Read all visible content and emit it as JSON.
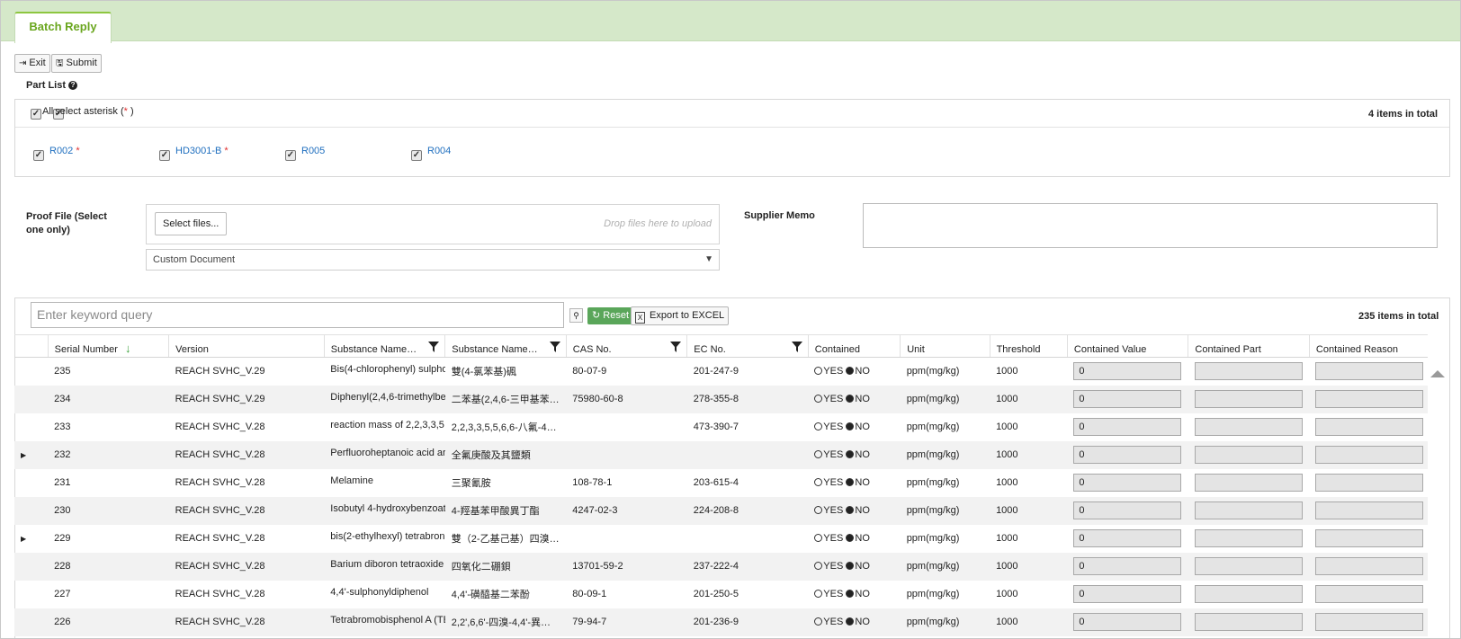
{
  "tab": {
    "label": "Batch Reply"
  },
  "toolbar": {
    "exit_label": "Exit",
    "submit_label": "Submit"
  },
  "part_list": {
    "title": "Part List",
    "all_label": "All",
    "select_asterisk_label": "select asterisk (",
    "asterisk": "*",
    "select_asterisk_close": " )",
    "total": "4 items in total",
    "parts": [
      {
        "label": "R002",
        "starred": "*"
      },
      {
        "label": "HD3001-B",
        "starred": "*"
      },
      {
        "label": "R005",
        "starred": ""
      },
      {
        "label": "R004",
        "starred": ""
      }
    ]
  },
  "proof_file": {
    "label_line1": "Proof File (Select",
    "label_line2": "one only)",
    "select_files": "Select files...",
    "drop_hint": "Drop files here to upload",
    "doc_type": "Custom Document"
  },
  "supplier_memo": {
    "label": "Supplier Memo",
    "value": ""
  },
  "grid": {
    "search_placeholder": "Enter keyword query",
    "reset_label": "Reset",
    "export_label": "Export to EXCEL",
    "total": "235 items in total",
    "columns": {
      "serial": "Serial Number",
      "version": "Version",
      "name_en": "Substance Name…",
      "name_zh": "Substance Name…",
      "cas": "CAS No.",
      "ec": "EC No.",
      "contained": "Contained",
      "unit": "Unit",
      "threshold": "Threshold",
      "value": "Contained Value",
      "part": "Contained Part",
      "reason": "Contained Reason"
    },
    "yes_label": "YES",
    "no_label": "NO",
    "rows": [
      {
        "expand": "",
        "serial": "235",
        "version": "REACH SVHC_V.29",
        "name_en": "Bis(4-chlorophenyl) sulpho",
        "name_zh": "雙(4-氯苯基)碸",
        "cas": "80-07-9",
        "ec": "201-247-9",
        "unit": "ppm(mg/kg)",
        "threshold": "1000",
        "value": "0"
      },
      {
        "expand": "",
        "serial": "234",
        "version": "REACH SVHC_V.29",
        "name_en": "Diphenyl(2,4,6-trimethylbe",
        "name_zh": "二苯基(2,4,6-三甲基苯…",
        "cas": "75980-60-8",
        "ec": "278-355-8",
        "unit": "ppm(mg/kg)",
        "threshold": "1000",
        "value": "0"
      },
      {
        "expand": "",
        "serial": "233",
        "version": "REACH SVHC_V.28",
        "name_en": "reaction mass of 2,2,3,3,5",
        "name_zh": "2,2,3,3,5,5,6,6-八氟-4…",
        "cas": "",
        "ec": "473-390-7",
        "unit": "ppm(mg/kg)",
        "threshold": "1000",
        "value": "0"
      },
      {
        "expand": "▶",
        "serial": "232",
        "version": "REACH SVHC_V.28",
        "name_en": "Perfluoroheptanoic acid ar",
        "name_zh": "全氟庚酸及其鹽類",
        "cas": "",
        "ec": "",
        "unit": "ppm(mg/kg)",
        "threshold": "1000",
        "value": "0"
      },
      {
        "expand": "",
        "serial": "231",
        "version": "REACH SVHC_V.28",
        "name_en": "Melamine",
        "name_zh": "三聚氰胺",
        "cas": "108-78-1",
        "ec": "203-615-4",
        "unit": "ppm(mg/kg)",
        "threshold": "1000",
        "value": "0"
      },
      {
        "expand": "",
        "serial": "230",
        "version": "REACH SVHC_V.28",
        "name_en": "Isobutyl 4-hydroxybenzoat",
        "name_zh": "4-羥基苯甲酸異丁酯",
        "cas": "4247-02-3",
        "ec": "224-208-8",
        "unit": "ppm(mg/kg)",
        "threshold": "1000",
        "value": "0"
      },
      {
        "expand": "▶",
        "serial": "229",
        "version": "REACH SVHC_V.28",
        "name_en": "bis(2-ethylhexyl) tetrabron",
        "name_zh": "雙（2-乙基己基）四溴…",
        "cas": "",
        "ec": "",
        "unit": "ppm(mg/kg)",
        "threshold": "1000",
        "value": "0"
      },
      {
        "expand": "",
        "serial": "228",
        "version": "REACH SVHC_V.28",
        "name_en": "Barium diboron tetraoxide",
        "name_zh": "四氧化二硼鋇",
        "cas": "13701-59-2",
        "ec": "237-222-4",
        "unit": "ppm(mg/kg)",
        "threshold": "1000",
        "value": "0"
      },
      {
        "expand": "",
        "serial": "227",
        "version": "REACH SVHC_V.28",
        "name_en": "4,4'-sulphonyldiphenol",
        "name_zh": "4,4'-磺醯基二苯酚",
        "cas": "80-09-1",
        "ec": "201-250-5",
        "unit": "ppm(mg/kg)",
        "threshold": "1000",
        "value": "0"
      },
      {
        "expand": "",
        "serial": "226",
        "version": "REACH SVHC_V.28",
        "name_en": "Tetrabromobisphenol A (TE",
        "name_zh": "2,2',6,6'-四溴-4,4'-異…",
        "cas": "79-94-7",
        "ec": "201-236-9",
        "unit": "ppm(mg/kg)",
        "threshold": "1000",
        "value": "0"
      }
    ]
  }
}
